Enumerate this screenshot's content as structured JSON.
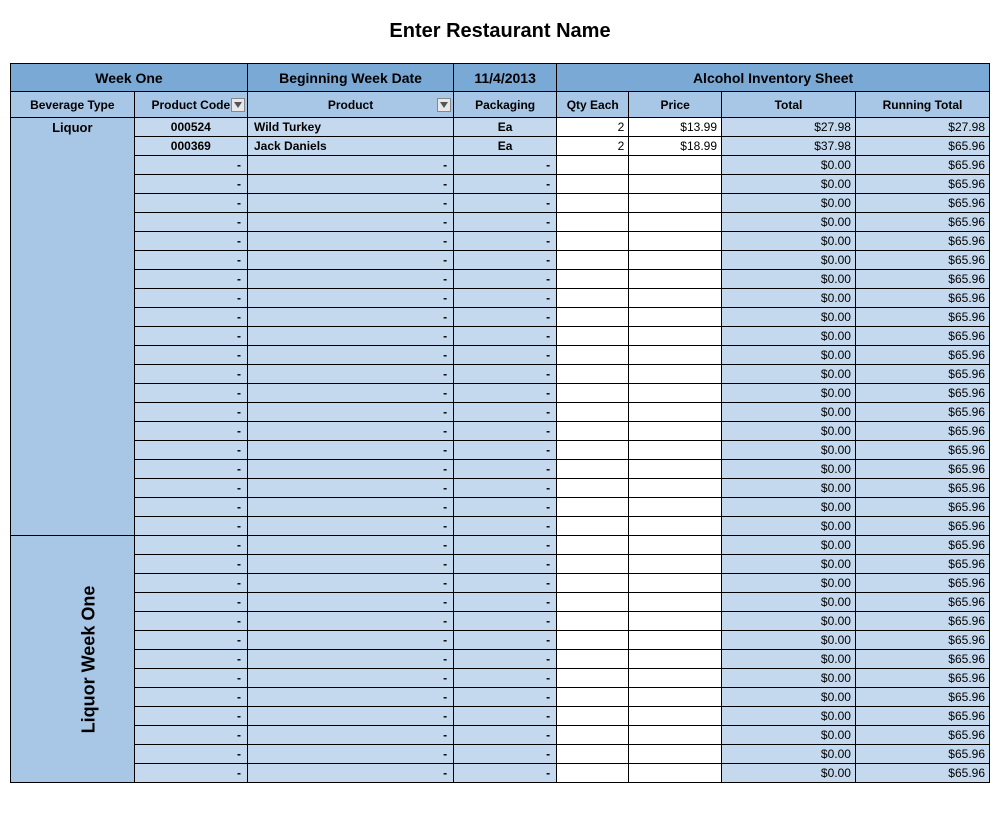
{
  "title": "Enter Restaurant Name",
  "header": {
    "week_label": "Week One",
    "begin_label": "Beginning Week Date",
    "begin_date": "11/4/2013",
    "sheet_label": "Alcohol Inventory Sheet"
  },
  "columns": {
    "bev_type": "Beverage Type",
    "code": "Product Code",
    "product": "Product",
    "packaging": "Packaging",
    "qty": "Qty Each",
    "price": "Price",
    "total": "Total",
    "running": "Running Total"
  },
  "bev_type_value": "Liquor",
  "side_label": "Liquor Week One",
  "rows": [
    {
      "code": "000524",
      "product": "Wild Turkey",
      "pkg": "Ea",
      "qty": "2",
      "price": "$13.99",
      "total": "$27.98",
      "running": "$27.98"
    },
    {
      "code": "000369",
      "product": "Jack Daniels",
      "pkg": "Ea",
      "qty": "2",
      "price": "$18.99",
      "total": "$37.98",
      "running": "$65.96"
    },
    {
      "code": "-",
      "product": "-",
      "pkg": "-",
      "qty": "",
      "price": "",
      "total": "$0.00",
      "running": "$65.96"
    },
    {
      "code": "-",
      "product": "-",
      "pkg": "-",
      "qty": "",
      "price": "",
      "total": "$0.00",
      "running": "$65.96"
    },
    {
      "code": "-",
      "product": "-",
      "pkg": "-",
      "qty": "",
      "price": "",
      "total": "$0.00",
      "running": "$65.96"
    },
    {
      "code": "-",
      "product": "-",
      "pkg": "-",
      "qty": "",
      "price": "",
      "total": "$0.00",
      "running": "$65.96"
    },
    {
      "code": "-",
      "product": "-",
      "pkg": "-",
      "qty": "",
      "price": "",
      "total": "$0.00",
      "running": "$65.96"
    },
    {
      "code": "-",
      "product": "-",
      "pkg": "-",
      "qty": "",
      "price": "",
      "total": "$0.00",
      "running": "$65.96"
    },
    {
      "code": "-",
      "product": "-",
      "pkg": "-",
      "qty": "",
      "price": "",
      "total": "$0.00",
      "running": "$65.96"
    },
    {
      "code": "-",
      "product": "-",
      "pkg": "-",
      "qty": "",
      "price": "",
      "total": "$0.00",
      "running": "$65.96"
    },
    {
      "code": "-",
      "product": "-",
      "pkg": "-",
      "qty": "",
      "price": "",
      "total": "$0.00",
      "running": "$65.96"
    },
    {
      "code": "-",
      "product": "-",
      "pkg": "-",
      "qty": "",
      "price": "",
      "total": "$0.00",
      "running": "$65.96"
    },
    {
      "code": "-",
      "product": "-",
      "pkg": "-",
      "qty": "",
      "price": "",
      "total": "$0.00",
      "running": "$65.96"
    },
    {
      "code": "-",
      "product": "-",
      "pkg": "-",
      "qty": "",
      "price": "",
      "total": "$0.00",
      "running": "$65.96"
    },
    {
      "code": "-",
      "product": "-",
      "pkg": "-",
      "qty": "",
      "price": "",
      "total": "$0.00",
      "running": "$65.96"
    },
    {
      "code": "-",
      "product": "-",
      "pkg": "-",
      "qty": "",
      "price": "",
      "total": "$0.00",
      "running": "$65.96"
    },
    {
      "code": "-",
      "product": "-",
      "pkg": "-",
      "qty": "",
      "price": "",
      "total": "$0.00",
      "running": "$65.96"
    },
    {
      "code": "-",
      "product": "-",
      "pkg": "-",
      "qty": "",
      "price": "",
      "total": "$0.00",
      "running": "$65.96"
    },
    {
      "code": "-",
      "product": "-",
      "pkg": "-",
      "qty": "",
      "price": "",
      "total": "$0.00",
      "running": "$65.96"
    },
    {
      "code": "-",
      "product": "-",
      "pkg": "-",
      "qty": "",
      "price": "",
      "total": "$0.00",
      "running": "$65.96"
    },
    {
      "code": "-",
      "product": "-",
      "pkg": "-",
      "qty": "",
      "price": "",
      "total": "$0.00",
      "running": "$65.96"
    },
    {
      "code": "-",
      "product": "-",
      "pkg": "-",
      "qty": "",
      "price": "",
      "total": "$0.00",
      "running": "$65.96"
    },
    {
      "code": "-",
      "product": "-",
      "pkg": "-",
      "qty": "",
      "price": "",
      "total": "$0.00",
      "running": "$65.96"
    },
    {
      "code": "-",
      "product": "-",
      "pkg": "-",
      "qty": "",
      "price": "",
      "total": "$0.00",
      "running": "$65.96"
    },
    {
      "code": "-",
      "product": "-",
      "pkg": "-",
      "qty": "",
      "price": "",
      "total": "$0.00",
      "running": "$65.96"
    },
    {
      "code": "-",
      "product": "-",
      "pkg": "-",
      "qty": "",
      "price": "",
      "total": "$0.00",
      "running": "$65.96"
    },
    {
      "code": "-",
      "product": "-",
      "pkg": "-",
      "qty": "",
      "price": "",
      "total": "$0.00",
      "running": "$65.96"
    },
    {
      "code": "-",
      "product": "-",
      "pkg": "-",
      "qty": "",
      "price": "",
      "total": "$0.00",
      "running": "$65.96"
    },
    {
      "code": "-",
      "product": "-",
      "pkg": "-",
      "qty": "",
      "price": "",
      "total": "$0.00",
      "running": "$65.96"
    },
    {
      "code": "-",
      "product": "-",
      "pkg": "-",
      "qty": "",
      "price": "",
      "total": "$0.00",
      "running": "$65.96"
    },
    {
      "code": "-",
      "product": "-",
      "pkg": "-",
      "qty": "",
      "price": "",
      "total": "$0.00",
      "running": "$65.96"
    },
    {
      "code": "-",
      "product": "-",
      "pkg": "-",
      "qty": "",
      "price": "",
      "total": "$0.00",
      "running": "$65.96"
    },
    {
      "code": "-",
      "product": "-",
      "pkg": "-",
      "qty": "",
      "price": "",
      "total": "$0.00",
      "running": "$65.96"
    },
    {
      "code": "-",
      "product": "-",
      "pkg": "-",
      "qty": "",
      "price": "",
      "total": "$0.00",
      "running": "$65.96"
    },
    {
      "code": "-",
      "product": "-",
      "pkg": "-",
      "qty": "",
      "price": "",
      "total": "$0.00",
      "running": "$65.96"
    }
  ]
}
